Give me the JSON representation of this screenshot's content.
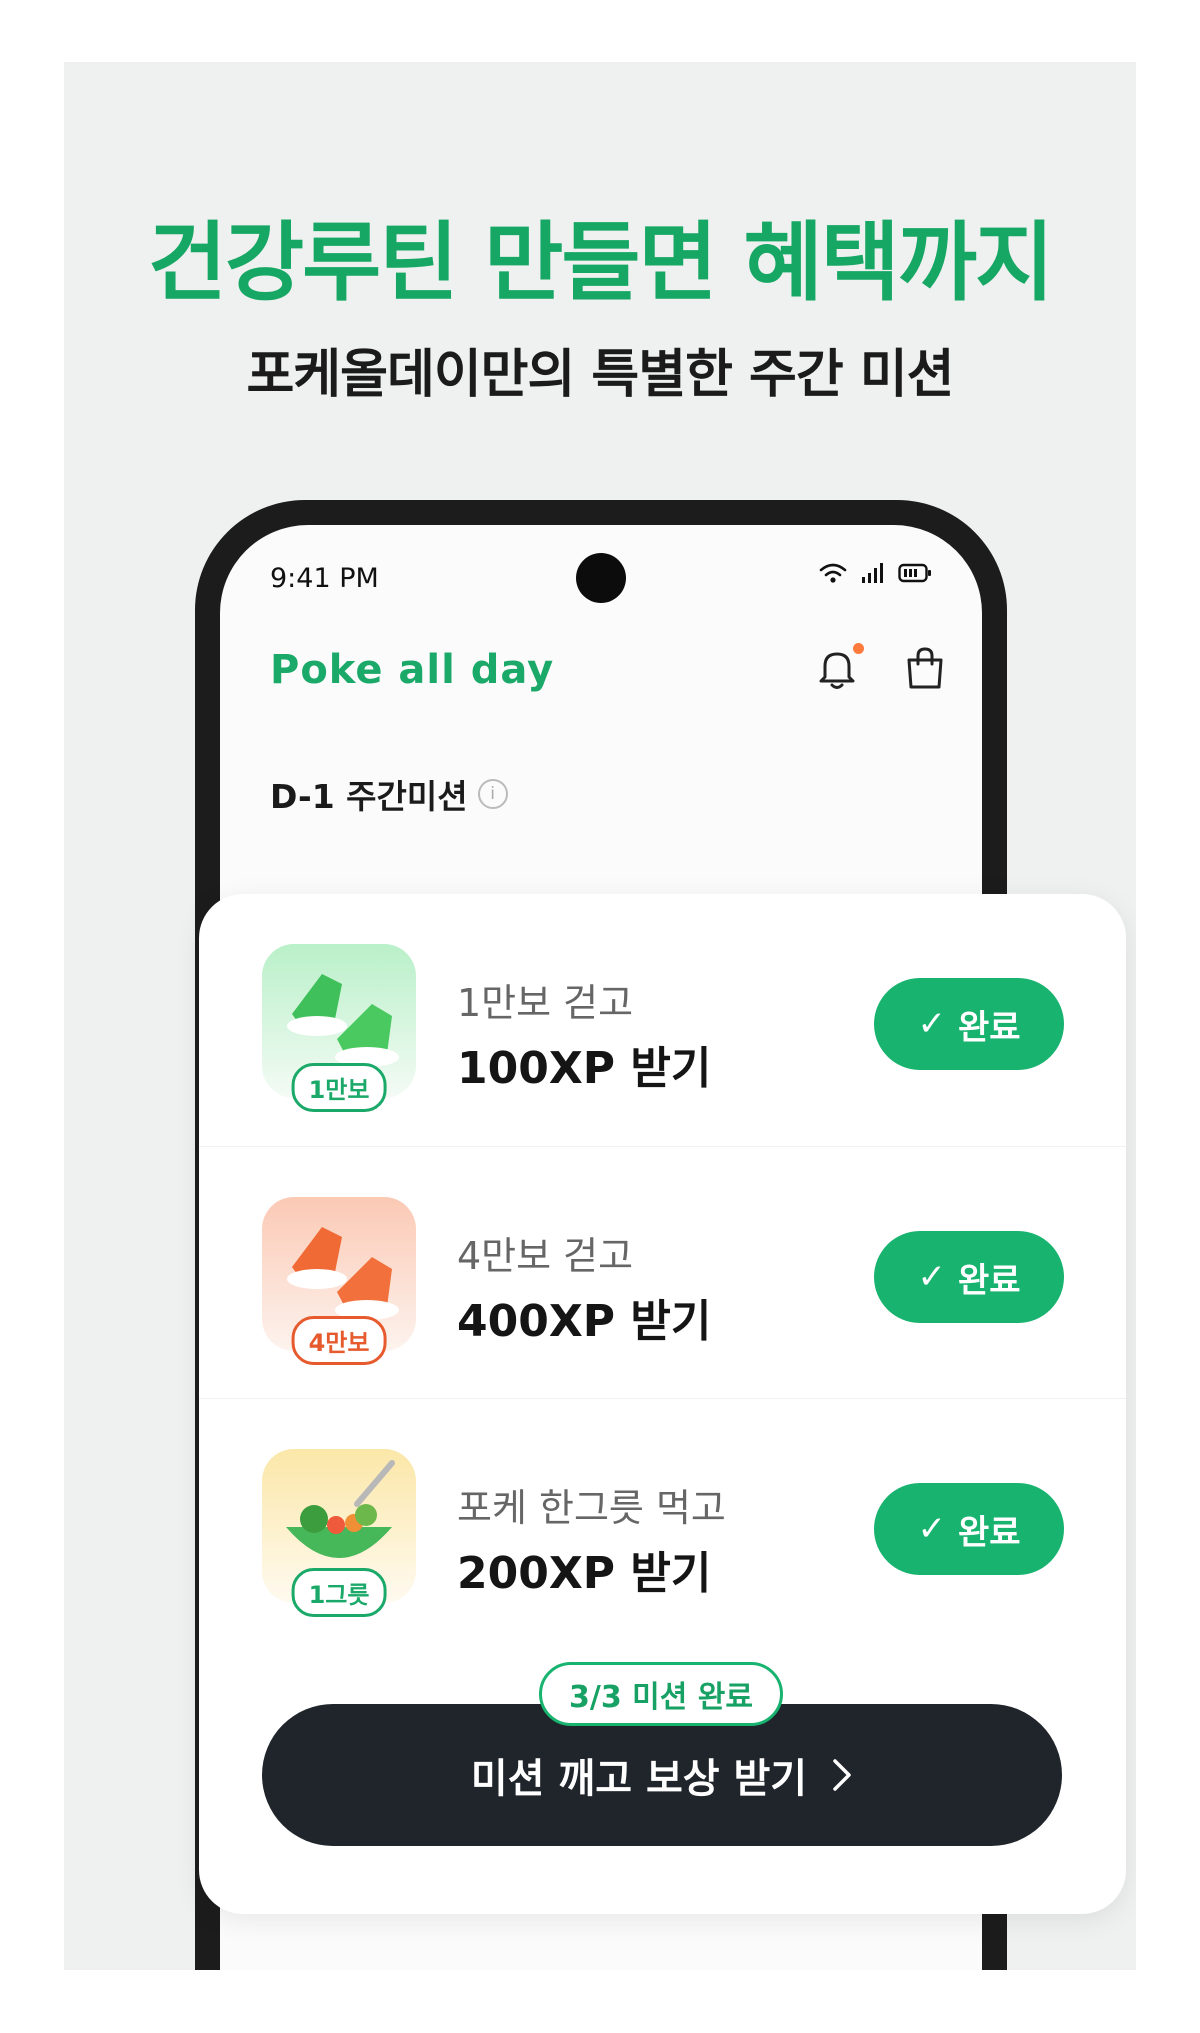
{
  "promo": {
    "headline": "건강루틴 만들면 혜택까지",
    "subheadline": "포케올데이만의 특별한 주간 미션"
  },
  "status_bar": {
    "time": "9:41 PM"
  },
  "app": {
    "brand": "Poke all day",
    "weekly_label": "D-1 주간미션",
    "icons": [
      "bell-icon",
      "shopping-bag-icon",
      "info-icon"
    ]
  },
  "missions": [
    {
      "title": "1만보 걷고",
      "reward": "100XP 받기",
      "badge": "1만보",
      "button": "완료",
      "icon": "green-sneakers-icon",
      "accent": "#1aa968"
    },
    {
      "title": "4만보 걷고",
      "reward": "400XP 받기",
      "badge": "4만보",
      "button": "완료",
      "icon": "orange-sneakers-icon",
      "accent": "#e65a2e"
    },
    {
      "title": "포케 한그릇 먹고",
      "reward": "200XP 받기",
      "badge": "1그릇",
      "button": "완료",
      "icon": "poke-bowl-icon",
      "accent": "#1aa968"
    }
  ],
  "progress": {
    "label": "3/3 미션 완료"
  },
  "cta": {
    "label": "미션 깨고 보상 받기"
  },
  "colors": {
    "brand_green": "#18b36f",
    "dark_button": "#1f252b",
    "background": "#eef1ef"
  }
}
